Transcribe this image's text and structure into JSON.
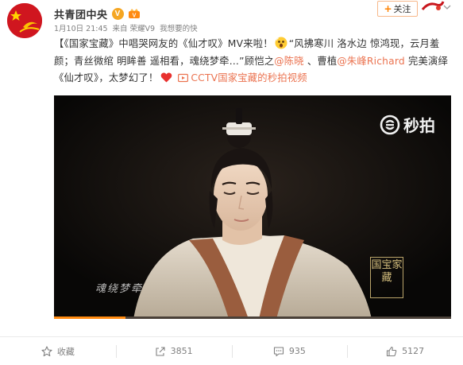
{
  "header": {
    "nickname": "共青团中央",
    "verified_badge": "V",
    "meta_date": "1月10日 21:45",
    "meta_source": "来自 荣耀V9",
    "meta_extra": "我想要的快",
    "follow_label": "关注",
    "follow_plus": "+"
  },
  "post": {
    "part1": "【《国家宝藏》中唱哭网友的《仙才叹》MV来啦！",
    "part2": "“风拂寒川 洛水边 惊鸿现，云月羞颜；青丝微绾 明眸善 遥相看，魂绕梦牵…”顾恺之",
    "mention1": "@陈晓",
    "sep": " 、曹植",
    "mention2": "@朱峰Richard",
    "part3": " 完美演绎《仙才叹》，太梦幻了！",
    "video_link": "CCTV国家宝藏的秒拍视频"
  },
  "video": {
    "watermark_text": "秒拍",
    "subtitle": "魂绕梦牵",
    "show_logo": "国宝家藏",
    "progress_percent": 18
  },
  "actions": {
    "favorite_label": "收藏",
    "repost_count": "3851",
    "comment_count": "935",
    "like_count": "5127"
  },
  "colors": {
    "link": "#eb7350",
    "accent": "#ff8200",
    "muted": "#808080"
  }
}
